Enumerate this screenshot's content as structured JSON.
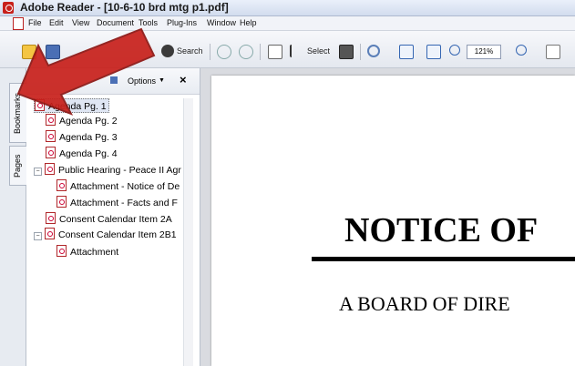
{
  "window": {
    "title": "Adobe Reader - [10-6-10 brd mtg p1.pdf]"
  },
  "menu": {
    "items": [
      {
        "label": "File"
      },
      {
        "label": "Edit"
      },
      {
        "label": "View"
      },
      {
        "label": "Document"
      },
      {
        "label": "Tools"
      },
      {
        "label": "Plug-Ins"
      },
      {
        "label": "Window"
      },
      {
        "label": "Help"
      }
    ]
  },
  "toolbar": {
    "search_label": "Search",
    "select_label": "Select",
    "zoom_value": "121%"
  },
  "panel": {
    "tabs": [
      {
        "label": "Bookmarks"
      },
      {
        "label": "Pages"
      }
    ],
    "options_label": "Options",
    "close_glyph": "×",
    "bookmarks": [
      {
        "label": "Agenda Pg. 1",
        "selected": true
      },
      {
        "label": "Agenda Pg. 2"
      },
      {
        "label": "Agenda Pg. 3"
      },
      {
        "label": "Agenda Pg. 4"
      },
      {
        "label": "Public Hearing - Peace II Agr",
        "expanded": true
      },
      {
        "label": "Attachment - Notice of De",
        "child": true
      },
      {
        "label": "Attachment - Facts and F",
        "child": true
      },
      {
        "label": "Consent Calendar Item 2A"
      },
      {
        "label": "Consent Calendar Item 2B1",
        "expanded": true
      },
      {
        "label": "Attachment",
        "child": true
      }
    ]
  },
  "document": {
    "heading": "NOTICE OF",
    "subheading": "A BOARD OF DIRE"
  },
  "colors": {
    "arrow": "#c8201b",
    "accent": "#2a5ea8",
    "selection": "#dfe6f3"
  },
  "icons": [
    "adobe-logo-icon",
    "open-folder-icon",
    "save-icon",
    "binoculars-icon",
    "hand-tool-icon",
    "camera-icon",
    "zoom-in-icon",
    "fit-page-icon",
    "fit-width-icon",
    "zoom-out-icon",
    "options-icon",
    "close-icon",
    "pdf-page-icon",
    "expand-icon"
  ]
}
